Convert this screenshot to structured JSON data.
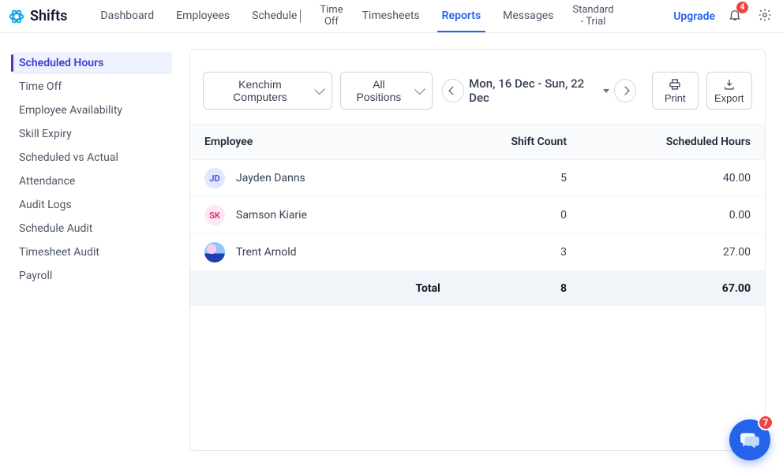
{
  "brand": {
    "name": "Shifts"
  },
  "nav": {
    "items": [
      {
        "label": "Dashboard"
      },
      {
        "label": "Employees"
      },
      {
        "label": "Schedule"
      },
      {
        "line1": "Time",
        "line2": "Off"
      },
      {
        "label": "Timesheets"
      },
      {
        "label": "Reports"
      },
      {
        "label": "Messages"
      },
      {
        "line1": "Standard",
        "line2": "- Trial"
      }
    ],
    "upgrade": "Upgrade",
    "notification_count": "4"
  },
  "sidebar": {
    "items": [
      "Scheduled Hours",
      "Time Off",
      "Employee Availability",
      "Skill Expiry",
      "Scheduled vs Actual",
      "Attendance",
      "Audit Logs",
      "Schedule Audit",
      "Timesheet Audit",
      "Payroll"
    ]
  },
  "toolbar": {
    "org_filter": "Kenchim Computers",
    "position_filter": "All Positions",
    "date_range": "Mon, 16 Dec - Sun, 22 Dec",
    "print": "Print",
    "export": "Export"
  },
  "table": {
    "headers": {
      "employee": "Employee",
      "shift_count": "Shift Count",
      "scheduled_hours": "Scheduled Hours"
    },
    "rows": [
      {
        "initials": "JD",
        "name": "Jayden Danns",
        "shift_count": "5",
        "hours": "40.00"
      },
      {
        "initials": "SK",
        "name": "Samson Kiarie",
        "shift_count": "0",
        "hours": "0.00"
      },
      {
        "initials": "",
        "name": "Trent Arnold",
        "shift_count": "3",
        "hours": "27.00"
      }
    ],
    "total": {
      "label": "Total",
      "shift_count": "8",
      "hours": "67.00"
    }
  },
  "chat": {
    "unread": "7"
  }
}
